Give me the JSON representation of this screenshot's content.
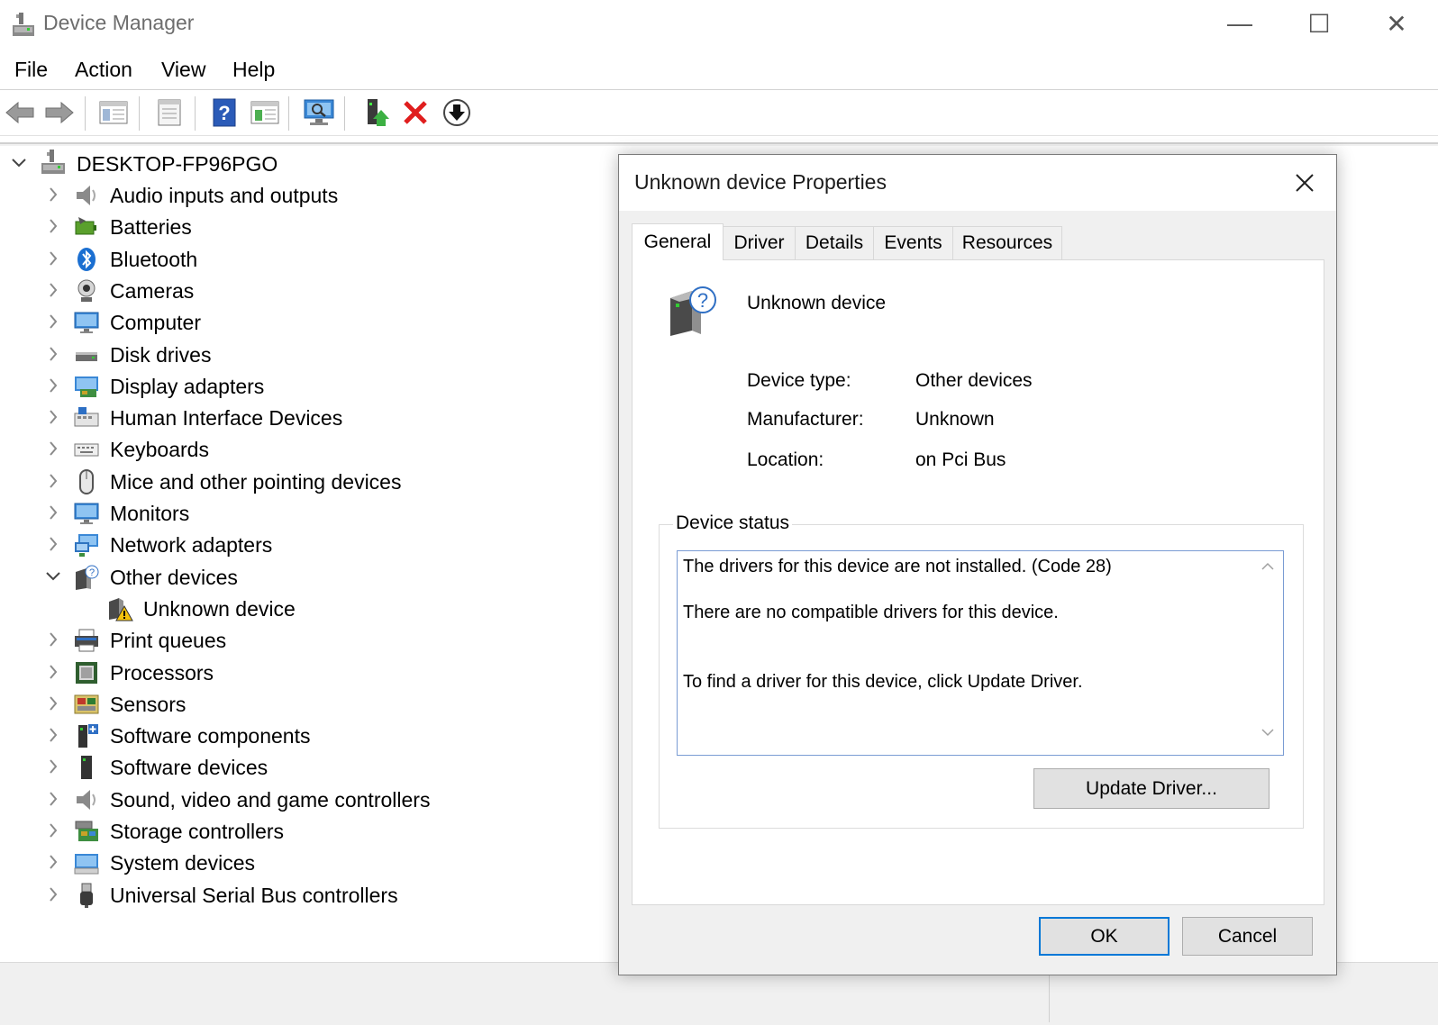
{
  "window": {
    "title": "Device Manager",
    "icon": "device-manager-icon",
    "controls": {
      "minimize": "—",
      "maximize": "☐",
      "close": "✕"
    }
  },
  "menu": [
    "File",
    "Action",
    "View",
    "Help"
  ],
  "toolbar": {
    "buttons": [
      "back-arrow-icon",
      "forward-arrow-icon",
      "show-hide-console-tree-icon",
      "properties-icon",
      "help-icon",
      "action-pane-icon",
      "scan-hardware-changes-icon",
      "update-driver-icon",
      "uninstall-device-icon",
      "disable-device-icon"
    ]
  },
  "tree": {
    "root": {
      "label": "DESKTOP-FP96PGO",
      "expanded": true
    },
    "items": [
      {
        "label": "Audio inputs and outputs",
        "icon": "speaker-icon"
      },
      {
        "label": "Batteries",
        "icon": "battery-icon"
      },
      {
        "label": "Bluetooth",
        "icon": "bluetooth-icon"
      },
      {
        "label": "Cameras",
        "icon": "webcam-icon"
      },
      {
        "label": "Computer",
        "icon": "monitor-icon"
      },
      {
        "label": "Disk drives",
        "icon": "disk-drive-icon"
      },
      {
        "label": "Display adapters",
        "icon": "display-adapter-icon"
      },
      {
        "label": "Human Interface Devices",
        "icon": "hid-icon"
      },
      {
        "label": "Keyboards",
        "icon": "keyboard-icon"
      },
      {
        "label": "Mice and other pointing devices",
        "icon": "mouse-icon"
      },
      {
        "label": "Monitors",
        "icon": "monitor-icon"
      },
      {
        "label": "Network adapters",
        "icon": "network-icon"
      },
      {
        "label": "Other devices",
        "icon": "unknown-device-icon",
        "expanded": true
      },
      {
        "label": "Unknown device",
        "icon": "warning-device-icon",
        "child": true
      },
      {
        "label": "Print queues",
        "icon": "printer-icon"
      },
      {
        "label": "Processors",
        "icon": "processor-icon"
      },
      {
        "label": "Sensors",
        "icon": "sensor-icon"
      },
      {
        "label": "Software components",
        "icon": "software-component-icon"
      },
      {
        "label": "Software devices",
        "icon": "software-device-icon"
      },
      {
        "label": "Sound, video and game controllers",
        "icon": "speaker-icon"
      },
      {
        "label": "Storage controllers",
        "icon": "storage-controller-icon"
      },
      {
        "label": "System devices",
        "icon": "system-device-icon"
      },
      {
        "label": "Universal Serial Bus controllers",
        "icon": "usb-icon"
      }
    ]
  },
  "dialog": {
    "title": "Unknown device Properties",
    "tabs": [
      "General",
      "Driver",
      "Details",
      "Events",
      "Resources"
    ],
    "active_tab": "General",
    "device_name": "Unknown device",
    "properties": [
      {
        "label": "Device type:",
        "value": "Other devices"
      },
      {
        "label": "Manufacturer:",
        "value": "Unknown"
      },
      {
        "label": "Location:",
        "value": "on Pci Bus"
      }
    ],
    "status_legend": "Device status",
    "status_lines": [
      "The drivers for this device are not installed. (Code 28)",
      "There are no compatible drivers for this device.",
      "To find a driver for this device, click Update Driver."
    ],
    "update_driver_label": "Update Driver...",
    "ok_label": "OK",
    "cancel_label": "Cancel"
  },
  "colors": {
    "accent": "#0078d7",
    "status_border": "#7a9cd3",
    "button_face": "#e1e1e1",
    "uninstall_red": "#e01e1e"
  }
}
